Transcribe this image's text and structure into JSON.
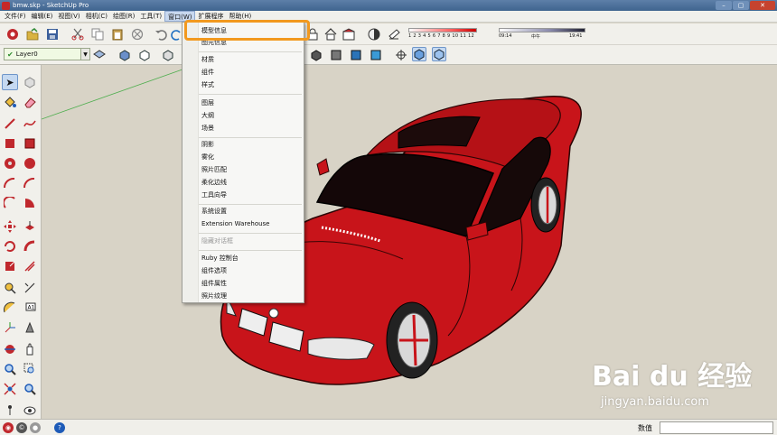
{
  "window": {
    "title": "bmw.skp - SketchUp Pro"
  },
  "menubar": {
    "items": [
      "文件(F)",
      "编辑(E)",
      "视图(V)",
      "相机(C)",
      "绘图(R)",
      "工具(T)",
      "窗口(W)",
      "扩展程序",
      "帮助(H)"
    ]
  },
  "toolbar": {
    "layer": "Layer0",
    "shadow_months": "1  2  3  4  5  6  7  8  9  10 11 12",
    "time_start": "09:14",
    "time_noon": "中午",
    "time_end": "19:41"
  },
  "window_menu": {
    "items": [
      "模型信息",
      "图元信息",
      "材质",
      "组件",
      "样式",
      "图层",
      "大纲",
      "场景",
      "阴影",
      "雾化",
      "照片匹配",
      "柔化边线",
      "工具向导",
      "系统设置",
      "Extension Warehouse",
      "隐藏对话框",
      "Ruby 控制台",
      "组件选项",
      "组件属性",
      "照片纹理"
    ],
    "highlighted": "模型信息",
    "disabled": "隐藏对话框"
  },
  "statusbar": {
    "vcb_label": "数值",
    "vcb_value": ""
  },
  "watermark": {
    "logo": "Bai du 经验",
    "url": "jingyan.baidu.com"
  },
  "colors": {
    "car_red": "#c8141a",
    "highlight": "#f2991f",
    "background": "#d8d3c6"
  }
}
